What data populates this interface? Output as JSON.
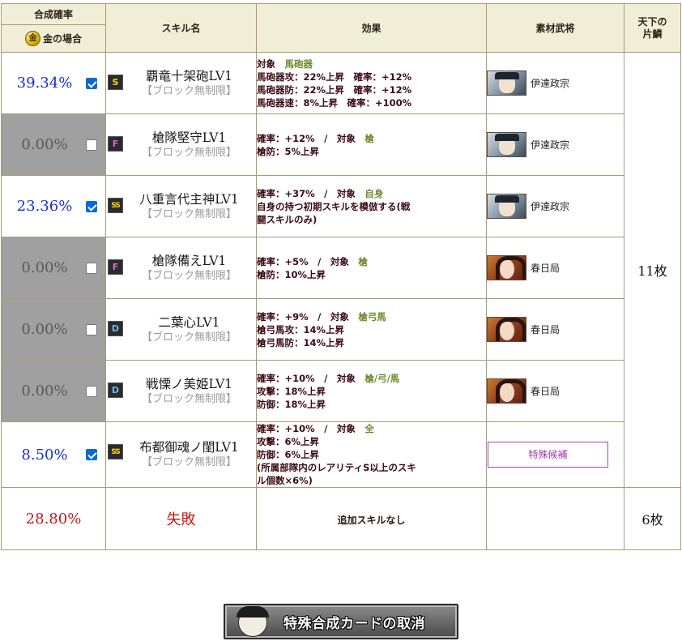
{
  "header": {
    "probability_title": "合成確率",
    "gold_icon_glyph": "金",
    "gold_case": "金の場合",
    "skill_name": "スキル名",
    "effect": "効果",
    "material": "素材武将",
    "tenka_line1": "天下の",
    "tenka_line2": "片鱗"
  },
  "rows": [
    {
      "probability": "39.34%",
      "checked": true,
      "rank": "S",
      "name": "覇竜十架砲LV1",
      "restriction": "【ブロック無制限】",
      "effect_lines": [
        [
          "対象　",
          "馬砲器"
        ],
        [
          "馬砲器攻：22%上昇　確率：+12%",
          ""
        ],
        [
          "馬砲器防：22%上昇　確率：+12%",
          ""
        ],
        [
          "馬砲器速：8%上昇　確率：+100%",
          ""
        ]
      ],
      "material": {
        "type": "officer",
        "portrait": "date",
        "name": "伊達政宗"
      }
    },
    {
      "probability": "0.00%",
      "checked": false,
      "rank": "F",
      "name": "槍隊堅守LV1",
      "restriction": "【ブロック無制限】",
      "effect_lines": [
        [
          "確率：+12%　/　対象　",
          "槍"
        ],
        [
          "槍防：5%上昇",
          ""
        ]
      ],
      "material": {
        "type": "officer",
        "portrait": "date",
        "name": "伊達政宗"
      }
    },
    {
      "probability": "23.36%",
      "checked": true,
      "rank": "SS",
      "name": "八重言代主神LV1",
      "restriction": "【ブロック無制限】",
      "effect_lines": [
        [
          "確率：+37%　/　対象　",
          "自身"
        ],
        [
          "自身の持つ初期スキルを模倣する(戦",
          ""
        ],
        [
          "闘スキルのみ)",
          ""
        ]
      ],
      "material": {
        "type": "officer",
        "portrait": "date",
        "name": "伊達政宗"
      }
    },
    {
      "probability": "0.00%",
      "checked": false,
      "rank": "F",
      "name": "槍隊備えLV1",
      "restriction": "【ブロック無制限】",
      "effect_lines": [
        [
          "確率：+5%　/　対象　",
          "槍"
        ],
        [
          "槍防：10%上昇",
          ""
        ]
      ],
      "material": {
        "type": "officer",
        "portrait": "kasuga",
        "name": "春日局"
      }
    },
    {
      "probability": "0.00%",
      "checked": false,
      "rank": "D",
      "name": "二葉心LV1",
      "restriction": "【ブロック無制限】",
      "effect_lines": [
        [
          "確率：+9%　/　対象　",
          "槍弓馬"
        ],
        [
          "槍弓馬攻：14%上昇",
          ""
        ],
        [
          "槍弓馬防：14%上昇",
          ""
        ]
      ],
      "material": {
        "type": "officer",
        "portrait": "kasuga",
        "name": "春日局"
      }
    },
    {
      "probability": "0.00%",
      "checked": false,
      "rank": "D",
      "name": "戦慄ノ美姫LV1",
      "restriction": "【ブロック無制限】",
      "effect_lines": [
        [
          "確率：+10%　/　対象　",
          "槍/弓/馬"
        ],
        [
          "攻撃：18%上昇",
          ""
        ],
        [
          "防御：18%上昇",
          ""
        ]
      ],
      "material": {
        "type": "officer",
        "portrait": "kasuga",
        "name": "春日局"
      }
    },
    {
      "probability": "8.50%",
      "checked": true,
      "rank": "SS",
      "name": "布都御魂ノ閨LV1",
      "restriction": "【ブロック無制限】",
      "effect_lines": [
        [
          "確率：+10%　/　対象　",
          "全"
        ],
        [
          "攻撃：6%上昇",
          ""
        ],
        [
          "防御：6%上昇",
          ""
        ],
        [
          "(所属部隊内のレアリティS以上のスキ",
          ""
        ],
        [
          "ル個数×6%)",
          ""
        ]
      ],
      "material": {
        "type": "button",
        "label": "特殊候補"
      }
    }
  ],
  "tenka_upper": "11枚",
  "result": {
    "probability": "28.80%",
    "outcome": "失敗",
    "additional": "追加スキルなし",
    "tenka": "6枚"
  },
  "cancel_button": {
    "label": "特殊合成カードの取消"
  },
  "colors": {
    "header_bg": "#f1eed8",
    "border": "#a89a74",
    "prob_on": "#1a2fcf",
    "prob_off_bg": "#a0a0a0",
    "effect_text": "#3a0a14",
    "target_text": "#6f8a2e",
    "fail_red": "#c41a1a",
    "special_purple": "#a534b0"
  }
}
